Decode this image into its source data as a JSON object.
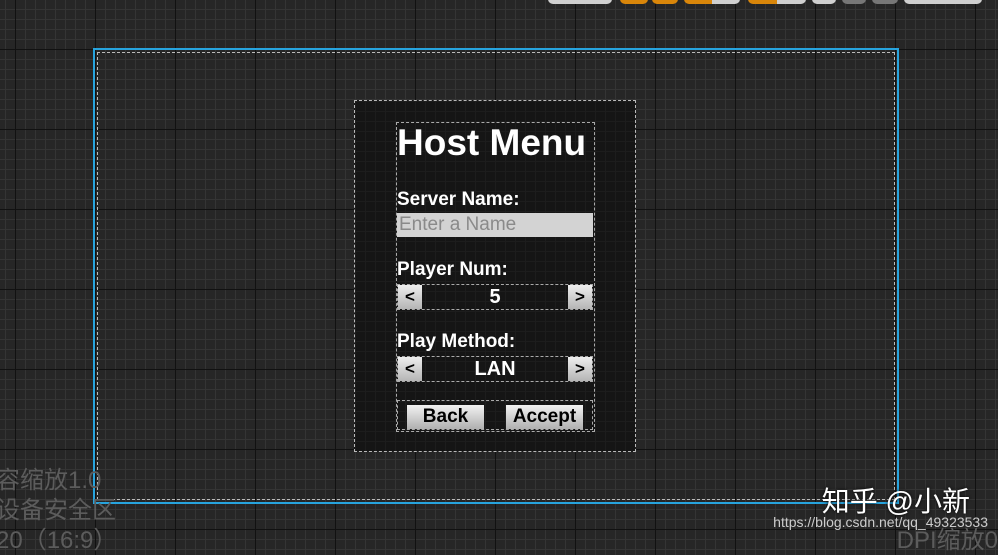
{
  "menu": {
    "title": "Host Menu",
    "server_name_label": "Server Name:",
    "server_name_placeholder": "Enter a Name",
    "server_name_value": "",
    "player_num_label": "Player Num:",
    "player_num_value": "5",
    "play_method_label": "Play Method:",
    "play_method_value": "LAN",
    "decrement": "<",
    "increment": ">",
    "back_label": "Back",
    "accept_label": "Accept"
  },
  "overlay": {
    "scale_text": "容缩放1.0",
    "safe_zone_text": "设备安全区",
    "resolution_text": "20（16:9）",
    "dpi_text": "DPI缩放0"
  },
  "watermark": {
    "brand": "知乎 @小新",
    "url": "https://blog.csdn.net/qq_49323533"
  },
  "colors": {
    "accent": "#27a4de",
    "toolbar_orange": "#d9860a"
  }
}
